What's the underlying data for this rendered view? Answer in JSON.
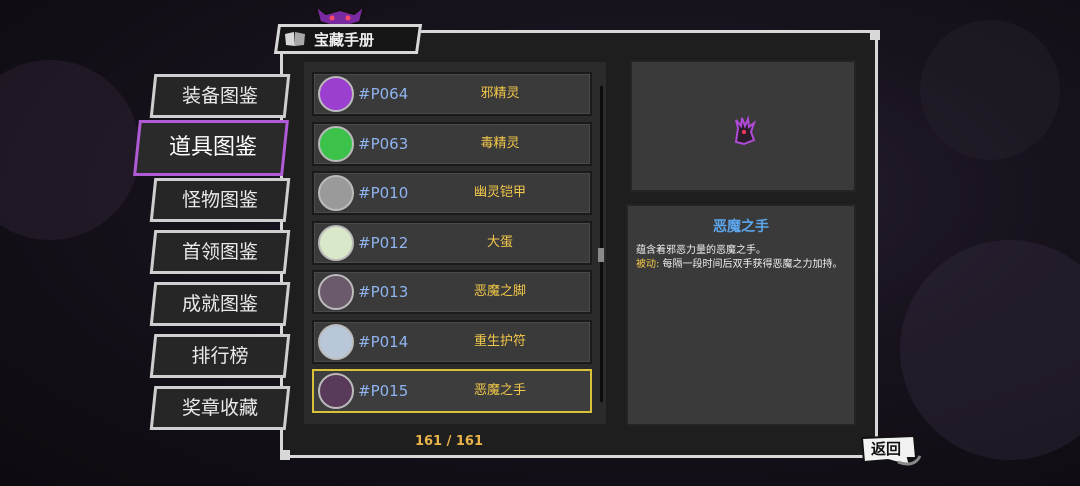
{
  "header": {
    "title": "宝藏手册"
  },
  "sidebar": {
    "tabs": [
      {
        "label": "装备图鉴",
        "active": false
      },
      {
        "label": "道具图鉴",
        "active": true
      },
      {
        "label": "怪物图鉴",
        "active": false
      },
      {
        "label": "首领图鉴",
        "active": false
      },
      {
        "label": "成就图鉴",
        "active": false
      },
      {
        "label": "排行榜",
        "active": false
      },
      {
        "label": "奖章收藏",
        "active": false
      }
    ]
  },
  "list": {
    "items": [
      {
        "code": "#P064",
        "name": "邪精灵",
        "icon": "evil-spirit-icon",
        "color": "#9b3fd0"
      },
      {
        "code": "#P063",
        "name": "毒精灵",
        "icon": "poison-spirit-icon",
        "color": "#3cc24a"
      },
      {
        "code": "#P010",
        "name": "幽灵铠甲",
        "icon": "ghost-armor-icon",
        "color": "#9a9a9a"
      },
      {
        "code": "#P012",
        "name": "大蛋",
        "icon": "big-egg-icon",
        "color": "#d8e8c8"
      },
      {
        "code": "#P013",
        "name": "恶魔之脚",
        "icon": "demon-foot-icon",
        "color": "#6a5a6a"
      },
      {
        "code": "#P014",
        "name": "重生护符",
        "icon": "rebirth-amulet-icon",
        "color": "#b8c8d8"
      },
      {
        "code": "#P015",
        "name": "恶魔之手",
        "icon": "demon-hand-icon",
        "color": "#5a3a5a",
        "selected": true
      }
    ],
    "counter": "161 / 161"
  },
  "detail": {
    "title": "恶魔之手",
    "description": "蕴含着邪恶力量的恶魔之手。",
    "passive_label": "被动:",
    "passive_text": " 每隔一段时间后双手获得恶魔之力加持。"
  },
  "back": {
    "label": "返回"
  },
  "colors": {
    "accent": "#b05ad6",
    "highlight": "#d8c23a",
    "code": "#8fb4f0",
    "name": "#f2c84a",
    "title": "#5ca6ee"
  }
}
